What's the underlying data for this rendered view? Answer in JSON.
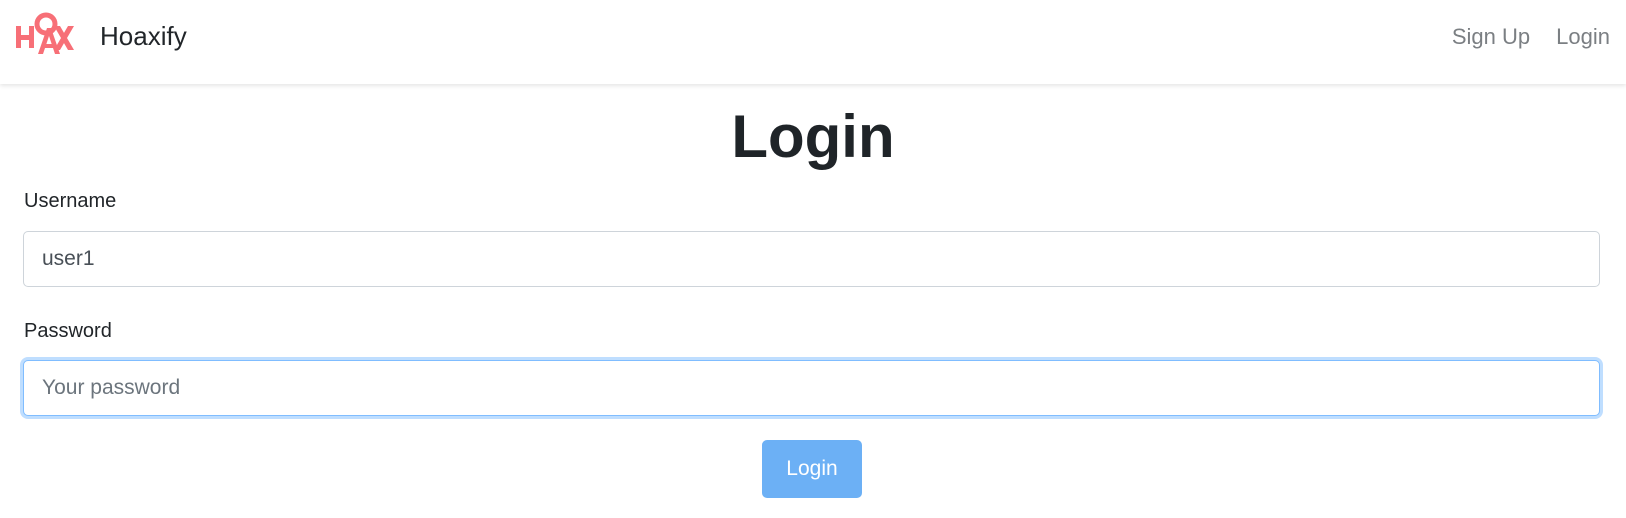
{
  "navbar": {
    "logo_text": "HOAX",
    "brand": "Hoaxify",
    "links": [
      "Sign Up",
      "Login"
    ]
  },
  "page": {
    "title": "Login"
  },
  "form": {
    "username": {
      "label": "Username",
      "value": "user1"
    },
    "password": {
      "label": "Password",
      "placeholder": "Your password",
      "value": ""
    },
    "submit_label": "Login"
  },
  "colors": {
    "logo": "#f7636c",
    "button_primary_disabled": "#6cb0f5",
    "focus_border": "#80bdff",
    "nav_link": "#7b7f83"
  }
}
